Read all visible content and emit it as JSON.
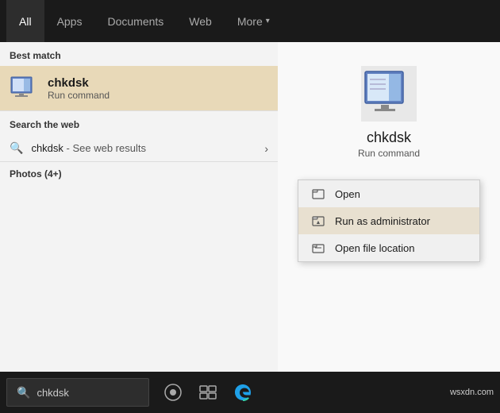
{
  "tabs": [
    {
      "id": "all",
      "label": "All",
      "active": true
    },
    {
      "id": "apps",
      "label": "Apps",
      "active": false
    },
    {
      "id": "documents",
      "label": "Documents",
      "active": false
    },
    {
      "id": "web",
      "label": "Web",
      "active": false
    },
    {
      "id": "more",
      "label": "More",
      "active": false,
      "has_arrow": true
    }
  ],
  "left_panel": {
    "best_match_label": "Best match",
    "best_match": {
      "name": "chkdsk",
      "subtitle": "Run command"
    },
    "web_search_label": "Search the web",
    "web_search": {
      "query": "chkdsk",
      "suffix": " - See web results"
    },
    "photos_label": "Photos (4+)"
  },
  "right_panel": {
    "app_name": "chkdsk",
    "app_type": "Run command",
    "context_menu": [
      {
        "id": "open",
        "label": "Open",
        "highlighted": false
      },
      {
        "id": "run-as-admin",
        "label": "Run as administrator",
        "highlighted": true
      },
      {
        "id": "open-location",
        "label": "Open file location",
        "highlighted": false
      }
    ]
  },
  "taskbar": {
    "search_placeholder": "chkdsk",
    "clock": "wsxdn.com"
  }
}
